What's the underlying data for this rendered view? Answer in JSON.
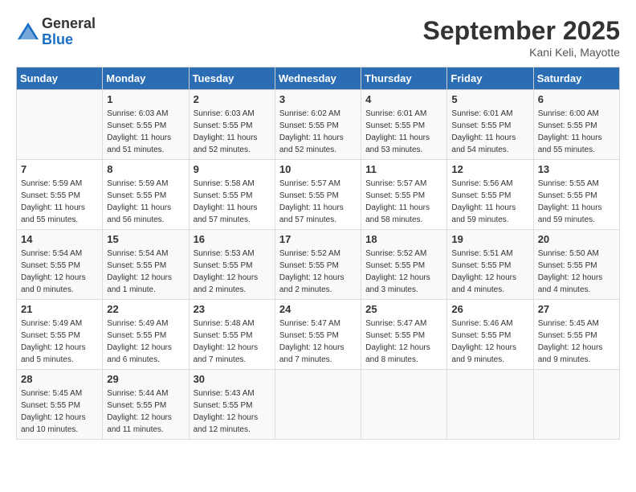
{
  "header": {
    "logo_general": "General",
    "logo_blue": "Blue",
    "title": "September 2025",
    "location": "Kani Keli, Mayotte"
  },
  "weekdays": [
    "Sunday",
    "Monday",
    "Tuesday",
    "Wednesday",
    "Thursday",
    "Friday",
    "Saturday"
  ],
  "weeks": [
    [
      {
        "day": "",
        "info": ""
      },
      {
        "day": "1",
        "info": "Sunrise: 6:03 AM\nSunset: 5:55 PM\nDaylight: 11 hours\nand 51 minutes."
      },
      {
        "day": "2",
        "info": "Sunrise: 6:03 AM\nSunset: 5:55 PM\nDaylight: 11 hours\nand 52 minutes."
      },
      {
        "day": "3",
        "info": "Sunrise: 6:02 AM\nSunset: 5:55 PM\nDaylight: 11 hours\nand 52 minutes."
      },
      {
        "day": "4",
        "info": "Sunrise: 6:01 AM\nSunset: 5:55 PM\nDaylight: 11 hours\nand 53 minutes."
      },
      {
        "day": "5",
        "info": "Sunrise: 6:01 AM\nSunset: 5:55 PM\nDaylight: 11 hours\nand 54 minutes."
      },
      {
        "day": "6",
        "info": "Sunrise: 6:00 AM\nSunset: 5:55 PM\nDaylight: 11 hours\nand 55 minutes."
      }
    ],
    [
      {
        "day": "7",
        "info": "Sunrise: 5:59 AM\nSunset: 5:55 PM\nDaylight: 11 hours\nand 55 minutes."
      },
      {
        "day": "8",
        "info": "Sunrise: 5:59 AM\nSunset: 5:55 PM\nDaylight: 11 hours\nand 56 minutes."
      },
      {
        "day": "9",
        "info": "Sunrise: 5:58 AM\nSunset: 5:55 PM\nDaylight: 11 hours\nand 57 minutes."
      },
      {
        "day": "10",
        "info": "Sunrise: 5:57 AM\nSunset: 5:55 PM\nDaylight: 11 hours\nand 57 minutes."
      },
      {
        "day": "11",
        "info": "Sunrise: 5:57 AM\nSunset: 5:55 PM\nDaylight: 11 hours\nand 58 minutes."
      },
      {
        "day": "12",
        "info": "Sunrise: 5:56 AM\nSunset: 5:55 PM\nDaylight: 11 hours\nand 59 minutes."
      },
      {
        "day": "13",
        "info": "Sunrise: 5:55 AM\nSunset: 5:55 PM\nDaylight: 11 hours\nand 59 minutes."
      }
    ],
    [
      {
        "day": "14",
        "info": "Sunrise: 5:54 AM\nSunset: 5:55 PM\nDaylight: 12 hours\nand 0 minutes."
      },
      {
        "day": "15",
        "info": "Sunrise: 5:54 AM\nSunset: 5:55 PM\nDaylight: 12 hours\nand 1 minute."
      },
      {
        "day": "16",
        "info": "Sunrise: 5:53 AM\nSunset: 5:55 PM\nDaylight: 12 hours\nand 2 minutes."
      },
      {
        "day": "17",
        "info": "Sunrise: 5:52 AM\nSunset: 5:55 PM\nDaylight: 12 hours\nand 2 minutes."
      },
      {
        "day": "18",
        "info": "Sunrise: 5:52 AM\nSunset: 5:55 PM\nDaylight: 12 hours\nand 3 minutes."
      },
      {
        "day": "19",
        "info": "Sunrise: 5:51 AM\nSunset: 5:55 PM\nDaylight: 12 hours\nand 4 minutes."
      },
      {
        "day": "20",
        "info": "Sunrise: 5:50 AM\nSunset: 5:55 PM\nDaylight: 12 hours\nand 4 minutes."
      }
    ],
    [
      {
        "day": "21",
        "info": "Sunrise: 5:49 AM\nSunset: 5:55 PM\nDaylight: 12 hours\nand 5 minutes."
      },
      {
        "day": "22",
        "info": "Sunrise: 5:49 AM\nSunset: 5:55 PM\nDaylight: 12 hours\nand 6 minutes."
      },
      {
        "day": "23",
        "info": "Sunrise: 5:48 AM\nSunset: 5:55 PM\nDaylight: 12 hours\nand 7 minutes."
      },
      {
        "day": "24",
        "info": "Sunrise: 5:47 AM\nSunset: 5:55 PM\nDaylight: 12 hours\nand 7 minutes."
      },
      {
        "day": "25",
        "info": "Sunrise: 5:47 AM\nSunset: 5:55 PM\nDaylight: 12 hours\nand 8 minutes."
      },
      {
        "day": "26",
        "info": "Sunrise: 5:46 AM\nSunset: 5:55 PM\nDaylight: 12 hours\nand 9 minutes."
      },
      {
        "day": "27",
        "info": "Sunrise: 5:45 AM\nSunset: 5:55 PM\nDaylight: 12 hours\nand 9 minutes."
      }
    ],
    [
      {
        "day": "28",
        "info": "Sunrise: 5:45 AM\nSunset: 5:55 PM\nDaylight: 12 hours\nand 10 minutes."
      },
      {
        "day": "29",
        "info": "Sunrise: 5:44 AM\nSunset: 5:55 PM\nDaylight: 12 hours\nand 11 minutes."
      },
      {
        "day": "30",
        "info": "Sunrise: 5:43 AM\nSunset: 5:55 PM\nDaylight: 12 hours\nand 12 minutes."
      },
      {
        "day": "",
        "info": ""
      },
      {
        "day": "",
        "info": ""
      },
      {
        "day": "",
        "info": ""
      },
      {
        "day": "",
        "info": ""
      }
    ]
  ]
}
